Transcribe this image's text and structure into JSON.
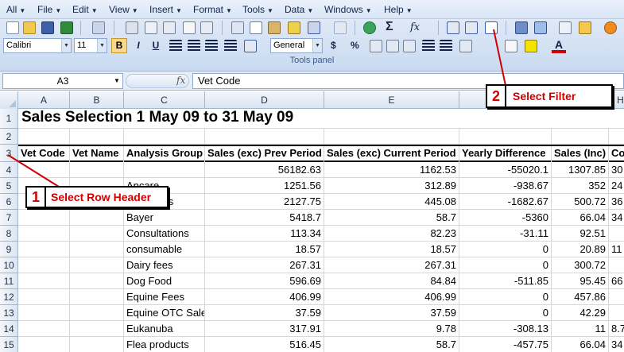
{
  "menu": [
    "All",
    "File",
    "Edit",
    "View",
    "Insert",
    "Format",
    "Tools",
    "Data",
    "Windows",
    "Help"
  ],
  "toolbar": {
    "font_name": "Calibri",
    "font_size": "11",
    "number_format": "General",
    "bold": "B",
    "italic": "I",
    "underline": "U",
    "currency": "$",
    "percent": "%",
    "sum": "Σ",
    "fx": "fx",
    "panel_label": "Tools panel"
  },
  "formula_bar": {
    "name_box": "A3",
    "fx_label": "fx",
    "content": "Vet Code"
  },
  "columns": [
    "A",
    "B",
    "C",
    "D",
    "E",
    "F",
    "G",
    "H"
  ],
  "row_numbers": [
    "1",
    "2",
    "3",
    "4",
    "5",
    "6",
    "7",
    "8",
    "9",
    "10",
    "11",
    "12",
    "13",
    "14",
    "15"
  ],
  "sheet": {
    "title": "Sales Selection 1 May 09 to 31 May 09",
    "headers": [
      "Vet Code",
      "Vet Name",
      "Analysis Group",
      "Sales (exc) Prev Period",
      "Sales (exc) Current Period",
      "Yearly Difference",
      "Sales (Inc)",
      "Cos"
    ],
    "rows": [
      [
        "",
        "",
        "",
        "56182.63",
        "1162.53",
        "-55020.1",
        "1307.85",
        "30"
      ],
      [
        "",
        "",
        "Ancare",
        "1251.56",
        "312.89",
        "-938.67",
        "352",
        "24"
      ],
      [
        "",
        "",
        "Antibiotics",
        "2127.75",
        "445.08",
        "-1682.67",
        "500.72",
        "36"
      ],
      [
        "",
        "",
        "Bayer",
        "5418.7",
        "58.7",
        "-5360",
        "66.04",
        "34"
      ],
      [
        "",
        "",
        "Consultations",
        "113.34",
        "82.23",
        "-31.11",
        "92.51",
        ""
      ],
      [
        "",
        "",
        "consumable",
        "18.57",
        "18.57",
        "0",
        "20.89",
        "11"
      ],
      [
        "",
        "",
        "Dairy fees",
        "267.31",
        "267.31",
        "0",
        "300.72",
        ""
      ],
      [
        "",
        "",
        "Dog Food",
        "596.69",
        "84.84",
        "-511.85",
        "95.45",
        "66"
      ],
      [
        "",
        "",
        "Equine Fees",
        "406.99",
        "406.99",
        "0",
        "457.86",
        ""
      ],
      [
        "",
        "",
        "Equine OTC Sale",
        "37.59",
        "37.59",
        "0",
        "42.29",
        ""
      ],
      [
        "",
        "",
        "Eukanuba",
        "317.91",
        "9.78",
        "-308.13",
        "11",
        "8.7"
      ],
      [
        "",
        "",
        "Flea products",
        "516.45",
        "58.7",
        "-457.75",
        "66.04",
        "34"
      ]
    ]
  },
  "callouts": [
    {
      "number": "1",
      "text": "Select Row Header"
    },
    {
      "number": "2",
      "text": "Select Filter"
    }
  ],
  "colors": {
    "callout_red": "#d00000",
    "header_blue": "#dbe5f1"
  }
}
